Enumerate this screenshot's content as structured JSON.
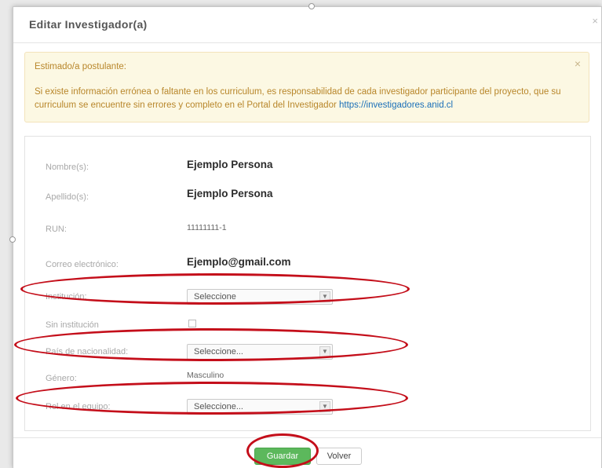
{
  "modal": {
    "title": "Editar Investigador(a)",
    "close_glyph": "×"
  },
  "alert": {
    "heading": "Estimado/a postulante:",
    "body": "Si existe información errónea o faltante en los curriculum, es responsabilidad de cada investigador participante del proyecto, que su curriculum se encuentre sin errores y completo en el Portal del Investigador ",
    "link_text": "https://investigadores.anid.cl",
    "close_glyph": "×"
  },
  "form": {
    "nombres_label": "Nombre(s):",
    "nombres_value": "Ejemplo Persona",
    "apellidos_label": "Apellido(s):",
    "apellidos_value": "Ejemplo Persona",
    "run_label": "RUN:",
    "run_value": "11111111-1",
    "correo_label": "Correo electrónico:",
    "correo_value": "Ejemplo@gmail.com",
    "institucion_label": "Institución:",
    "institucion_value": "Seleccione",
    "sin_institucion_label": "Sin institución",
    "pais_label": "País de nacionalidad:",
    "pais_value": "Seleccione...",
    "genero_label": "Género:",
    "genero_value": "Masculino",
    "rol_label": "Rol en el equipo:",
    "rol_value": "Seleccione..."
  },
  "footer": {
    "save_label": "Guardar",
    "back_label": "Volver"
  },
  "colors": {
    "highlight": "#c40e1a",
    "save_button": "#5cb85c",
    "alert_bg": "#fcf8e3"
  },
  "icons": {
    "select_arrow": "chevron-down-icon"
  }
}
